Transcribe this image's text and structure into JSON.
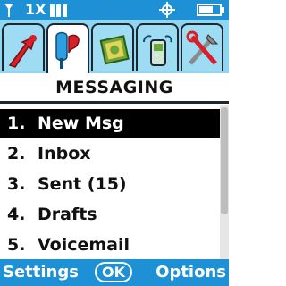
{
  "status": {
    "network_label": "1X",
    "signal_bars": 3,
    "battery_level": 0.7
  },
  "tabs": [
    {
      "name": "recent-calls-icon",
      "active": false
    },
    {
      "name": "messaging-icon",
      "active": true
    },
    {
      "name": "media-icon",
      "active": false
    },
    {
      "name": "phone-settings-icon",
      "active": false
    },
    {
      "name": "tools-icon",
      "active": false
    }
  ],
  "header": {
    "title": "MESSAGING"
  },
  "menu": {
    "items": [
      {
        "num": "1.",
        "label": "New Msg",
        "selected": true
      },
      {
        "num": "2.",
        "label": "Inbox"
      },
      {
        "num": "3.",
        "label": "Sent (15)"
      },
      {
        "num": "4.",
        "label": "Drafts"
      },
      {
        "num": "5.",
        "label": "Voicemail"
      }
    ]
  },
  "softkeys": {
    "left": "Settings",
    "center": "OK",
    "right": "Options"
  },
  "colors": {
    "bar_blue": "#1e90d6",
    "tab_bg": "#8fd6f2",
    "selection": "#000000"
  }
}
